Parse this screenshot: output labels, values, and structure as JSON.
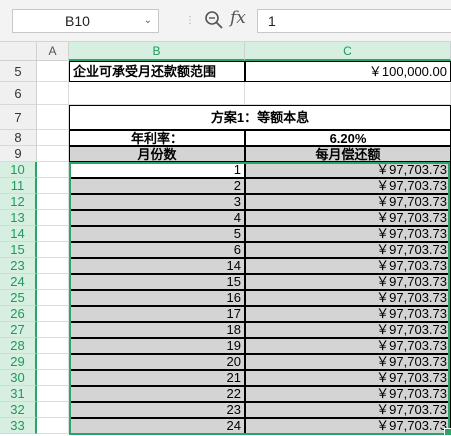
{
  "namebox": {
    "value": "B10"
  },
  "formula": {
    "value": "1",
    "fx_label": "fx"
  },
  "columns": [
    "A",
    "B",
    "C"
  ],
  "rows_top": [
    {
      "num": "5",
      "b": "企业可承受月还款额范围",
      "c": "￥100,000.00"
    },
    {
      "num": "6",
      "b": "",
      "c": ""
    },
    {
      "num": "7",
      "title": "方案1：等额本息"
    },
    {
      "num": "8",
      "b": "年利率：",
      "c": "6.20%"
    },
    {
      "num": "9",
      "b": "月份数",
      "c": "每月偿还额"
    }
  ],
  "data_rows": [
    {
      "num": "10",
      "month": "1",
      "pay": "￥97,703.73"
    },
    {
      "num": "11",
      "month": "2",
      "pay": "￥97,703.73"
    },
    {
      "num": "12",
      "month": "3",
      "pay": "￥97,703.73"
    },
    {
      "num": "13",
      "month": "4",
      "pay": "￥97,703.73"
    },
    {
      "num": "14",
      "month": "5",
      "pay": "￥97,703.73"
    },
    {
      "num": "15",
      "month": "6",
      "pay": "￥97,703.73"
    },
    {
      "num": "23",
      "month": "14",
      "pay": "￥97,703.73"
    },
    {
      "num": "24",
      "month": "15",
      "pay": "￥97,703.73"
    },
    {
      "num": "25",
      "month": "16",
      "pay": "￥97,703.73"
    },
    {
      "num": "26",
      "month": "17",
      "pay": "￥97,703.73"
    },
    {
      "num": "27",
      "month": "18",
      "pay": "￥97,703.73"
    },
    {
      "num": "28",
      "month": "19",
      "pay": "￥97,703.73"
    },
    {
      "num": "29",
      "month": "20",
      "pay": "￥97,703.73"
    },
    {
      "num": "30",
      "month": "21",
      "pay": "￥97,703.73"
    },
    {
      "num": "31",
      "month": "22",
      "pay": "￥97,703.73"
    },
    {
      "num": "32",
      "month": "23",
      "pay": "￥97,703.73"
    },
    {
      "num": "33",
      "month": "24",
      "pay": "￥97,703.73"
    }
  ],
  "colors": {
    "selection": "#2aa568",
    "header_fill": "#d4d4d4"
  }
}
